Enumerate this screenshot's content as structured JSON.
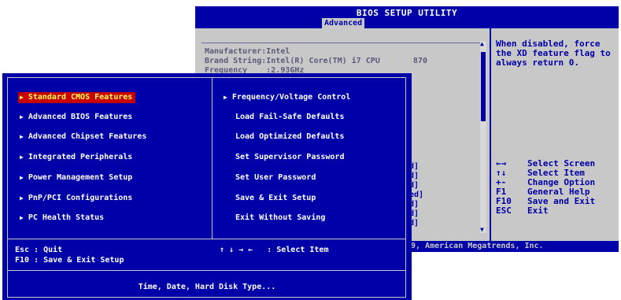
{
  "ami": {
    "title": "BIOS SETUP UTILITY",
    "active_tab": "Advanced",
    "info_lines": [
      "Manufacturer:Intel",
      "Brand String:Intel(R) Core(TM) i7 CPU       870",
      "Frequency    :2.93GHz"
    ],
    "help_text": "When disabled, force the XD feature flag to always return 0.",
    "keys": [
      {
        "key": "←→",
        "desc": "Select Screen"
      },
      {
        "key": "↑↓",
        "desc": "Select Item"
      },
      {
        "key": "+-",
        "desc": "Change Option"
      },
      {
        "key": "F1",
        "desc": "General Help"
      },
      {
        "key": "F10",
        "desc": "Save and Exit"
      },
      {
        "key": "ESC",
        "desc": "Exit"
      }
    ],
    "value_fragments": [
      "d]",
      "d]",
      "d]",
      "ed]",
      "d]",
      "d]",
      "d]"
    ],
    "footer": "9, American Megatrends, Inc."
  },
  "award": {
    "menu_left": [
      "Standard CMOS Features",
      "Advanced BIOS Features",
      "Advanced Chipset Features",
      "Integrated Peripherals",
      "Power Management Setup",
      "PnP/PCI Configurations",
      "PC Health Status"
    ],
    "menu_right": [
      "Frequency/Voltage Control",
      "Load Fail-Safe Defaults",
      "Load Optimized Defaults",
      "Set Supervisor Password",
      "Set User Password",
      "Save & Exit Setup",
      "Exit Without Saving"
    ],
    "status_esc": "Esc : Quit",
    "status_f10": "F10 : Save & Exit Setup",
    "status_nav": "↑ ↓ → ←   : Select Item",
    "description": "Time, Date, Hard Disk Type...",
    "arrow_glyph": "▶",
    "selected_color": "#c80000",
    "background_color": "#0000a8"
  }
}
